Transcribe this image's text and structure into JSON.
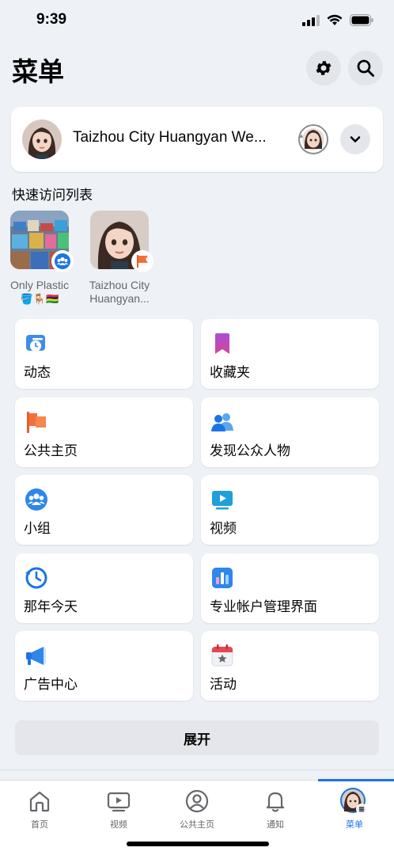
{
  "status": {
    "time": "9:39"
  },
  "header": {
    "title": "菜单"
  },
  "profile": {
    "name": "Taizhou City Huangyan We..."
  },
  "shortcuts_section": {
    "title": "快速访问列表"
  },
  "shortcuts": [
    {
      "label_line1": "Only Plastic",
      "label_line2": "🪣🪑🇲🇺"
    },
    {
      "label_line1": "Taizhou City",
      "label_line2": "Huangyan..."
    }
  ],
  "tiles": [
    {
      "label": "动态",
      "icon": "feeds-icon"
    },
    {
      "label": "收藏夹",
      "icon": "saved-bookmark-icon"
    },
    {
      "label": "公共主页",
      "icon": "pages-flag-icon"
    },
    {
      "label": "发现公众人物",
      "icon": "discover-people-icon"
    },
    {
      "label": "小组",
      "icon": "groups-icon"
    },
    {
      "label": "视频",
      "icon": "video-icon"
    },
    {
      "label": "那年今天",
      "icon": "memories-clock-icon"
    },
    {
      "label": "专业帐户管理界面",
      "icon": "professional-dashboard-icon"
    },
    {
      "label": "广告中心",
      "icon": "ad-center-megaphone-icon"
    },
    {
      "label": "活动",
      "icon": "events-calendar-icon"
    }
  ],
  "expand": {
    "label": "展开"
  },
  "tabbar": {
    "items": [
      {
        "label": "首页",
        "icon": "home-icon"
      },
      {
        "label": "视频",
        "icon": "video-tab-icon"
      },
      {
        "label": "公共主页",
        "icon": "profile-tab-icon"
      },
      {
        "label": "通知",
        "icon": "bell-icon"
      },
      {
        "label": "菜单",
        "icon": "menu-avatar-icon"
      }
    ],
    "active_index": 4
  },
  "colors": {
    "accent": "#1b74e4",
    "background": "#eef1f6"
  }
}
